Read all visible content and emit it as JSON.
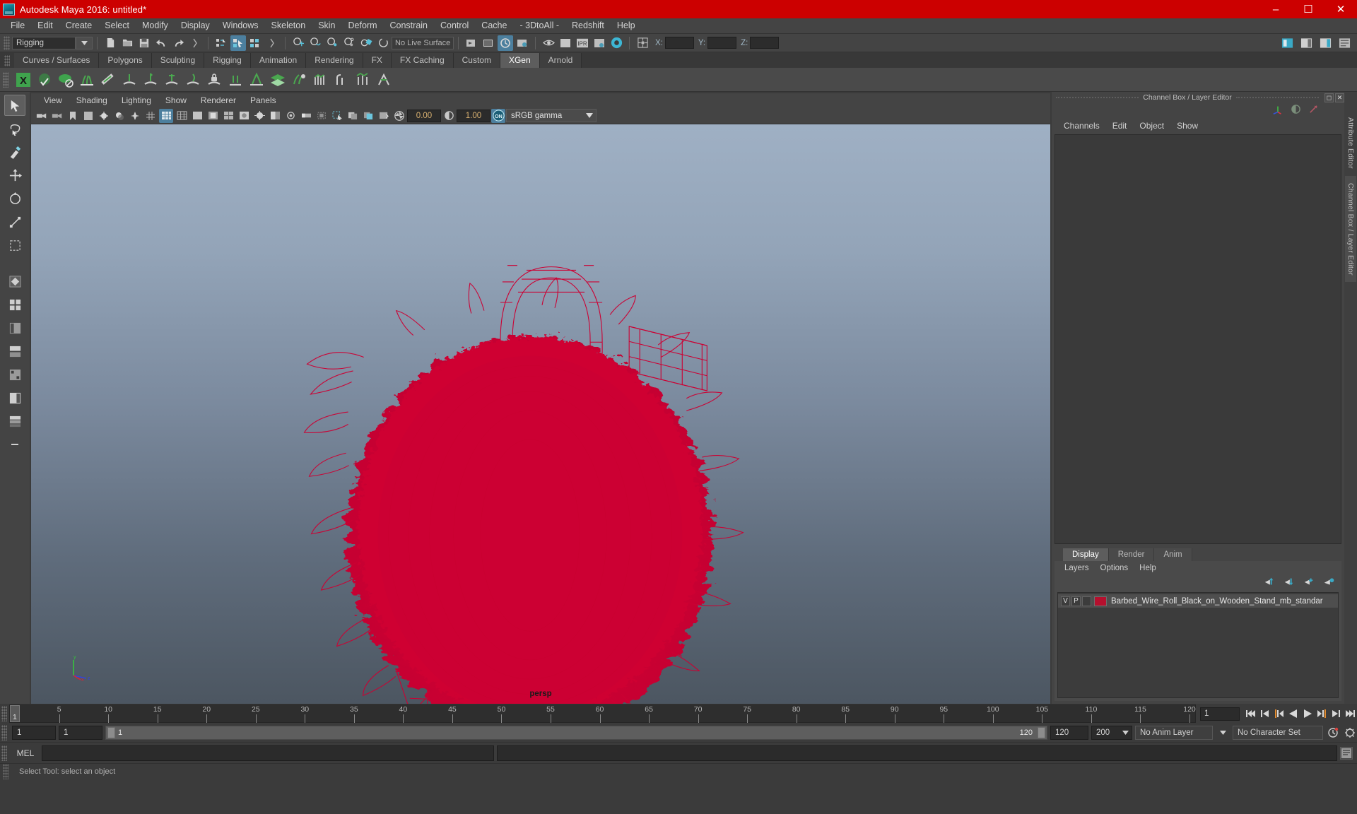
{
  "window": {
    "title": "Autodesk Maya 2016: untitled*",
    "app_icon": "maya-logo-icon",
    "controls": {
      "minimize": "minimize-icon",
      "maximize": "maximize-icon",
      "close": "close-icon"
    },
    "title_bg": "#cc0000"
  },
  "menubar": {
    "items": [
      "File",
      "Edit",
      "Create",
      "Select",
      "Modify",
      "Display",
      "Windows",
      "Skeleton",
      "Skin",
      "Deform",
      "Constrain",
      "Control",
      "Cache",
      "- 3DtoAll -",
      "Redshift",
      "Help"
    ]
  },
  "statusline": {
    "mode": "Rigging",
    "live_surface": "No Live Surface",
    "coords": {
      "x_label": "X:",
      "x_value": "",
      "y_label": "Y:",
      "y_value": "",
      "z_label": "Z:",
      "z_value": ""
    }
  },
  "shelf_tabs": {
    "items": [
      "Curves / Surfaces",
      "Polygons",
      "Sculpting",
      "Rigging",
      "Animation",
      "Rendering",
      "FX",
      "FX Caching",
      "Custom",
      "XGen",
      "Arnold"
    ],
    "active": "XGen"
  },
  "viewport_panel": {
    "menus": [
      "View",
      "Shading",
      "Lighting",
      "Show",
      "Renderer",
      "Panels"
    ],
    "exposure": "0.00",
    "gamma": "1.00",
    "color_mgmt_toggle": "ON",
    "view_transform": "sRGB gamma",
    "camera_label": "persp"
  },
  "right_dock": {
    "title": "Channel Box / Layer Editor",
    "menus": [
      "Channels",
      "Edit",
      "Object",
      "Show"
    ],
    "layer_tabs": {
      "items": [
        "Display",
        "Render",
        "Anim"
      ],
      "active": "Display"
    },
    "layer_menus": [
      "Layers",
      "Options",
      "Help"
    ],
    "layers": [
      {
        "visibility": "V",
        "playback": "P",
        "color": "#b5102e",
        "name": "Barbed_Wire_Roll_Black_on_Wooden_Stand_mb_standar"
      }
    ],
    "vertical_tabs": [
      "Attribute Editor",
      "Channel Box / Layer Editor"
    ]
  },
  "timeline": {
    "ticks": [
      5,
      10,
      15,
      20,
      25,
      30,
      35,
      40,
      45,
      50,
      55,
      60,
      65,
      70,
      75,
      80,
      85,
      90,
      95,
      100,
      105,
      110,
      115,
      120
    ],
    "current_frame": "1",
    "current_frame_field": "1",
    "start": 1,
    "end": 120
  },
  "range_slider": {
    "anim_start": "1",
    "range_start": "1",
    "bar_start": "1",
    "bar_end": "120",
    "range_end": "120",
    "anim_end": "200",
    "anim_layer": "No Anim Layer",
    "character_set": "No Character Set"
  },
  "command_line": {
    "label": "MEL",
    "input_value": "",
    "output_value": ""
  },
  "help_line": {
    "text": "Select Tool: select an object"
  },
  "scene": {
    "model_color": "#cc0033",
    "object_name": "Barbed_Wire_Roll_Black_on_Wooden_Stand"
  },
  "toolbox": {
    "tools": [
      "select-tool",
      "lasso-select-tool",
      "paint-select-tool",
      "move-tool",
      "rotate-tool",
      "scale-tool",
      "last-tool",
      "outliner-layout",
      "persp-outliner-layout",
      "hypergraph-layout",
      "persp-graph-layout",
      "persp-layout",
      "four-view-layout",
      "two-pane-stacked-layout",
      "minus-button"
    ]
  }
}
